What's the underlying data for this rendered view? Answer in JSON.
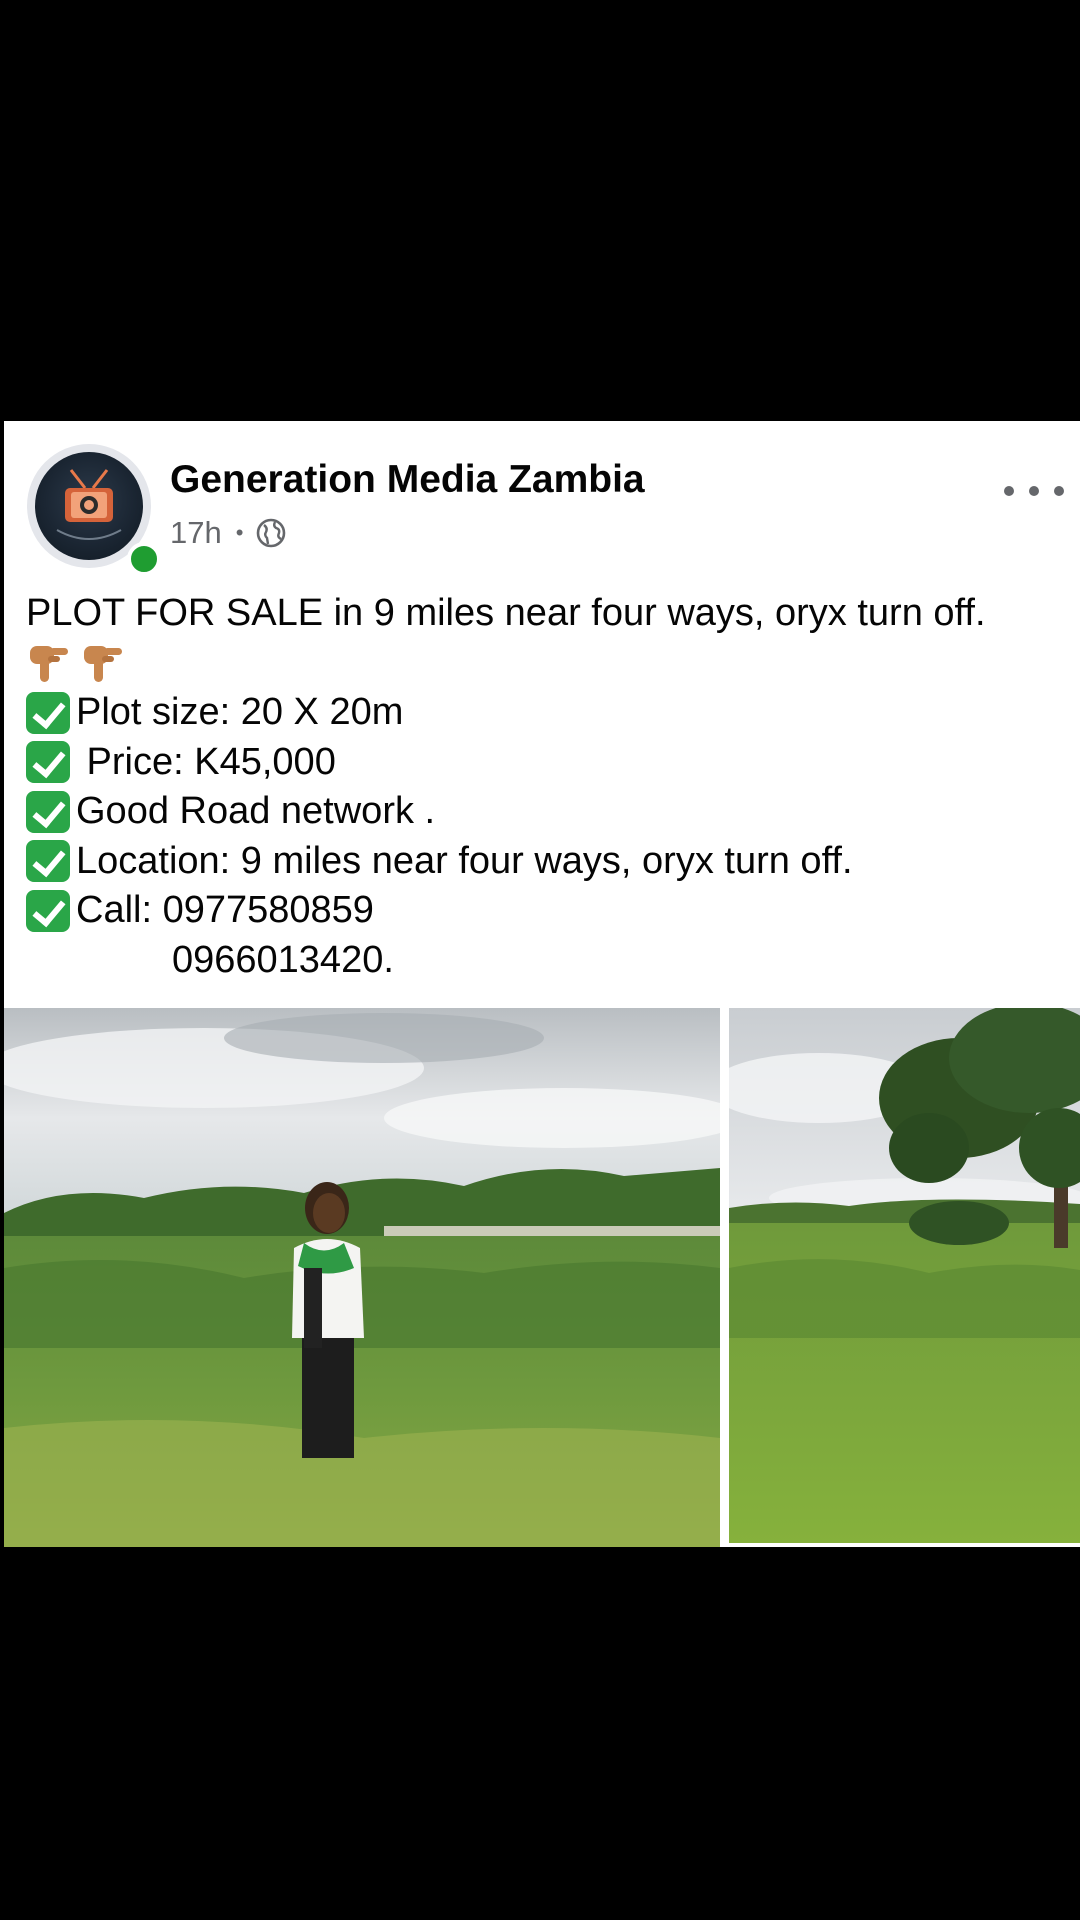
{
  "post": {
    "page_name": "Generation Media Zambia",
    "time": "17h",
    "separator": "•",
    "audience_icon": "globe-icon",
    "more_icon": "more-options-icon",
    "lines": {
      "headline": "PLOT FOR SALE in 9 miles near four ways, oryx turn off.",
      "plot_size": "Plot size: 20 X 20m",
      "price": " Price: K45,000",
      "road": "Good Road network .",
      "location": "Location: 9 miles near four ways, oryx turn off.",
      "call": "Call: 0977580859",
      "call_alt": "0966013420."
    },
    "photos": [
      {
        "name": "woman standing in a grassy field"
      },
      {
        "name": "grassy plot with a large tree"
      }
    ],
    "colors": {
      "online_dot": "#1f9d31",
      "check_box": "#2aa648",
      "text": "#050505",
      "meta_text": "#65676b"
    }
  }
}
